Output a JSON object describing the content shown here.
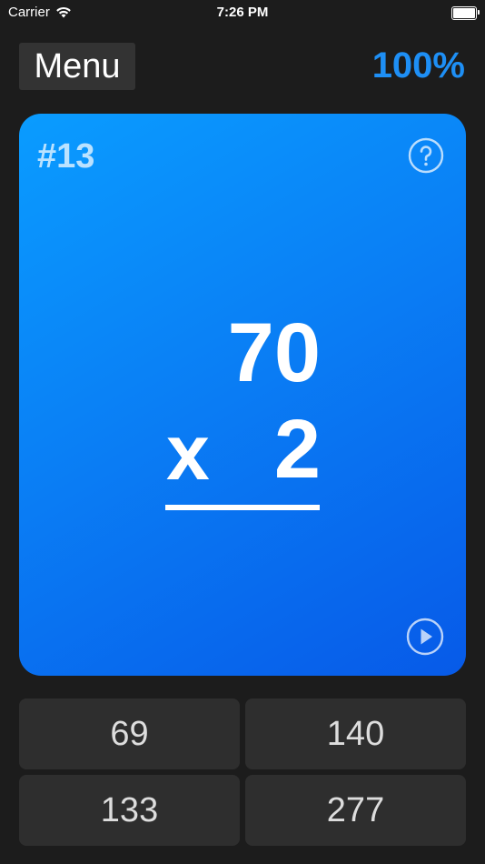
{
  "status_bar": {
    "carrier": "Carrier",
    "time": "7:26 PM"
  },
  "header": {
    "menu_label": "Menu",
    "score": "100%"
  },
  "card": {
    "number": "#13",
    "top_operand": "70",
    "operator": "x",
    "bottom_operand": "2",
    "icons": [
      "help-icon",
      "play-icon"
    ]
  },
  "answers": [
    "69",
    "140",
    "133",
    "277"
  ],
  "colors": {
    "background": "#1c1c1c",
    "accent": "#1e8ff5",
    "card_gradient_start": "#0a9cff",
    "card_gradient_end": "#075ae8",
    "button_bg": "#2e2e2e"
  }
}
